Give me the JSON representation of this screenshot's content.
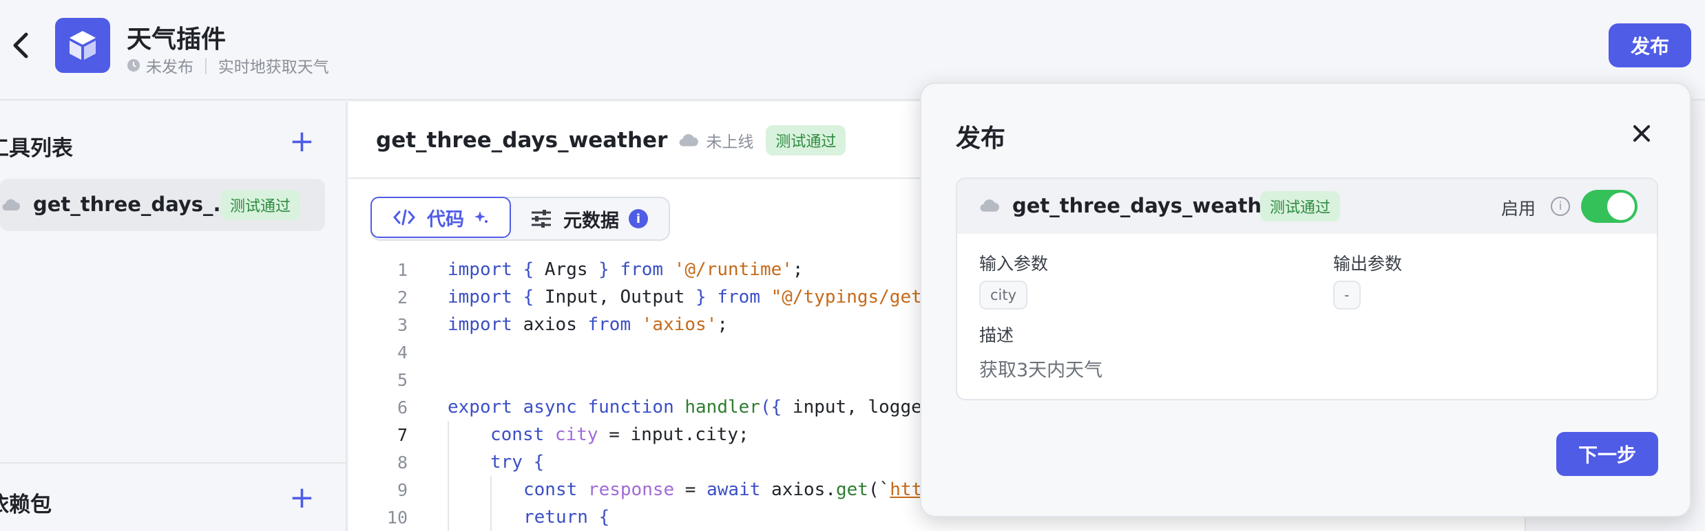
{
  "header": {
    "title": "天气插件",
    "status": "未发布",
    "description": "实时地获取天气",
    "publish_label": "发布"
  },
  "sidebar": {
    "tools_title": "工具列表",
    "tool_name": "get_three_days_...",
    "tool_tag": "测试通过",
    "deps_title": "依赖包"
  },
  "main": {
    "tool_name": "get_three_days_weather",
    "online_status": "未上线",
    "test_tag": "测试通过",
    "tabs": {
      "code": "代码",
      "metadata": "元数据",
      "metadata_badge": "i"
    }
  },
  "code": {
    "line_numbers": [
      "1",
      "2",
      "3",
      "4",
      "5",
      "6",
      "7",
      "8",
      "9",
      "10"
    ],
    "l1": {
      "a": "import ",
      "b": "{",
      "c": " Args ",
      "d": "}",
      "e": " from ",
      "f": "'@/runtime'",
      "g": ";"
    },
    "l2": {
      "a": "import ",
      "b": "{",
      "c": " Input, Output ",
      "d": "}",
      "e": " from ",
      "f": "\"@/typings/get_"
    },
    "l3": {
      "a": "import",
      "b": " axios ",
      "c": "from",
      "d": " 'axios'",
      "e": ";"
    },
    "l6": {
      "a": "export async function ",
      "b": "handler",
      "c": "({",
      "d": " input, logge"
    },
    "l7": {
      "a": "const ",
      "b": "city",
      "c": " = input.city;"
    },
    "l8": {
      "a": "try",
      "b": " {"
    },
    "l9": {
      "a": "const ",
      "b": "response",
      "c": " = ",
      "d": "await",
      "e": " axios.",
      "f": "get",
      "g": "(`",
      "h": "http"
    },
    "l10": {
      "a": "return",
      "b": " {"
    }
  },
  "modal": {
    "title": "发布",
    "tool_name": "get_three_days_weather",
    "tool_tag": "测试通过",
    "enable_label": "启用",
    "enabled": true,
    "input_label": "输入参数",
    "input_chip": "city",
    "output_label": "输出参数",
    "output_chip": "-",
    "desc_label": "描述",
    "desc_text": "获取3天内天气",
    "next_label": "下一步"
  },
  "colors": {
    "accent": "#4f5ce6",
    "success": "#34c15a",
    "tag_bg": "#d9f2dd"
  },
  "icons": [
    "back-arrow-icon",
    "cube-icon",
    "clock-icon",
    "plus-icon",
    "cloud-icon",
    "code-icon",
    "sparkle-icon",
    "sliders-icon",
    "info-icon",
    "close-icon"
  ]
}
